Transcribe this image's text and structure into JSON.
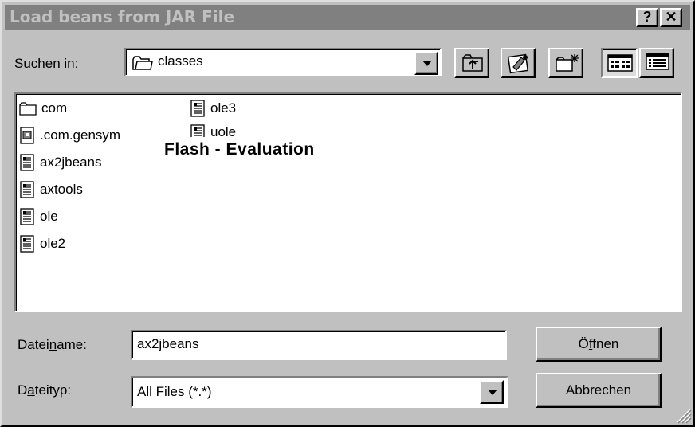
{
  "window": {
    "title": "Load beans from JAR File",
    "help_button": "?",
    "close_button": "✕"
  },
  "lookin": {
    "label_prefix": "",
    "label_mnemonic": "S",
    "label_rest": "uchen in:",
    "value": "classes"
  },
  "toolbar": {
    "icons": [
      "up-folder-icon",
      "desktop-icon",
      "new-folder-icon",
      "list-view-icon",
      "details-view-icon"
    ]
  },
  "files": [
    {
      "name": "com",
      "type": "folder"
    },
    {
      "name": ".com.gensym",
      "type": "special"
    },
    {
      "name": "ax2jbeans",
      "type": "doc"
    },
    {
      "name": "axtools",
      "type": "doc"
    },
    {
      "name": "ole",
      "type": "doc"
    },
    {
      "name": "ole2",
      "type": "doc"
    },
    {
      "name": "ole3",
      "type": "doc"
    },
    {
      "name": "uole",
      "type": "doc"
    }
  ],
  "watermark": "Flash - Evaluation",
  "filename": {
    "label_prefix": "Datei",
    "label_mnemonic": "n",
    "label_rest": "ame:",
    "value": "ax2jbeans"
  },
  "filetype": {
    "label_prefix": "D",
    "label_mnemonic": "a",
    "label_rest": "teityp:",
    "value": "All Files (*.*)"
  },
  "buttons": {
    "open_prefix": "Ö",
    "open_mnemonic": "f",
    "open_rest": "fnen",
    "cancel": "Abbrechen"
  },
  "colors": {
    "face": "#c0c0c0",
    "titlebar_inactive": "#808080",
    "title_text": "#c0c0c0"
  }
}
